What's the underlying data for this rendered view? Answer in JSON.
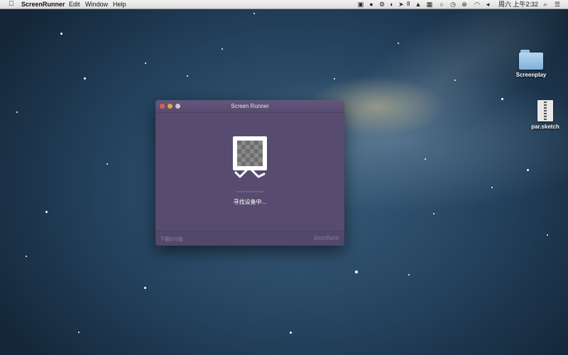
{
  "menubar": {
    "apple_icon": "apple-logo-icon",
    "app_name": "ScreenRunner",
    "menus": [
      "Edit",
      "Window",
      "Help"
    ],
    "status_badge_count": "8",
    "clock": "周六 上午2:32"
  },
  "desktop": {
    "icons": [
      {
        "label": "Screenplay",
        "kind": "folder-icon"
      },
      {
        "label": "par.sketch",
        "kind": "archive-file-icon"
      }
    ]
  },
  "window": {
    "title": "Screen Runner",
    "status_text": "寻找设备中...",
    "footer_link": "下载iOS版",
    "brand": "Iconfans"
  },
  "colors": {
    "window_bg": "#574c6f",
    "menubar_bg": "#e6e6e6",
    "close": "#e25a55",
    "minimize": "#e0a93a"
  }
}
